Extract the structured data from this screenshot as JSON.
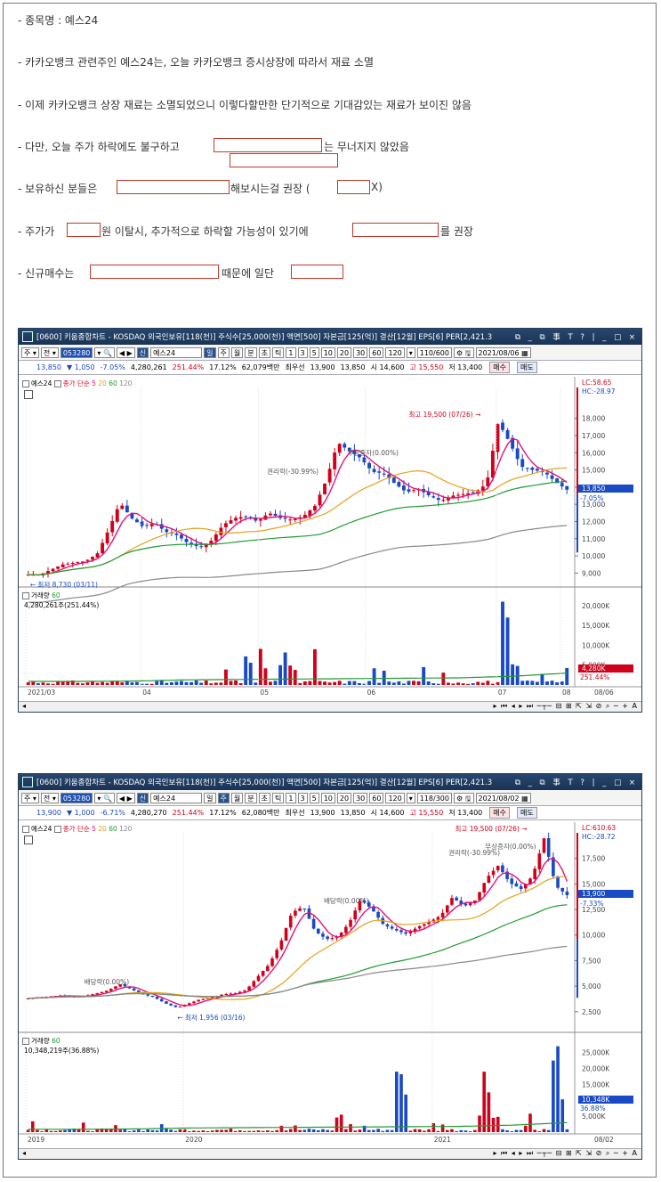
{
  "text": {
    "line1": "- 종목명 : 예스24",
    "line2": "- 카카오뱅크 관련주인 예스24는, 오늘 카카오뱅크 증시상장에 따라서 재료 소멸",
    "line3": "- 이제 카카오뱅크 상장 재료는 소멸되었으니 이렇다할만한 단기적으로 기대감있는 재료가 보이진 않음",
    "line4a": "- 다만, 오늘 주가 하락에도 불구하고",
    "line4b": "는 무너지지 않았음",
    "line5a": "- 보유하신 분들은",
    "line5b": "해보시는걸 권장 (",
    "line5c": "X)",
    "line6a": "- 주가가",
    "line6b": "원 이탈시, 추가적으로 하락할 가능성이 있기에",
    "line6c": "를 권장",
    "line7a": "- 신규매수는",
    "line7b": "때문에 일단"
  },
  "colors": {
    "up": "#d0021b",
    "down": "#1a49c6",
    "ma5": "#e0137a",
    "ma20": "#e6a11a",
    "ma60": "#1e9b32",
    "ma120": "#888888",
    "accent": "#27476f"
  },
  "charts": [
    {
      "title": "[0600] 키움종합차트 - KOSDAQ 외국인보유[118(천)] 주식수[25,000(천)] 액면[500] 자본금[125(억)] 결산[12월] EPS[6] PER[2,421.3",
      "window_controls": "⧉ _ ⧉ 事 T ? | _ □ ×",
      "toolbar": {
        "b1": "주",
        "b2": "전",
        "code": "053280",
        "name_tag": "신",
        "stock": "예스24",
        "period_day": "일",
        "period_week": "주",
        "period_month": "월",
        "period_min": "분",
        "period_sec": "초",
        "period_tick": "틱",
        "intervals": [
          "1",
          "3",
          "5",
          "10",
          "20",
          "30",
          "60",
          "120"
        ],
        "count": "110/600",
        "date": "2021/08/06"
      },
      "quote": {
        "price": "13,850",
        "arrow": "▼",
        "change": "1,050",
        "change_pct": "-7.05%",
        "volume": "4,280,261",
        "vol_ratio": "251.44%",
        "turnover": "17.12%",
        "amount": "62,079백만",
        "best_ask_label": "최우선",
        "ask": "13,900",
        "bid": "13,850",
        "open_label": "시",
        "open": "14,600",
        "high_label": "고",
        "high": "15,550",
        "low_label": "저",
        "low": "13,400",
        "buy": "매수",
        "sell": "매도"
      },
      "legend_price": {
        "name": "예스24",
        "ma_label": "종가 단순",
        "ma": [
          "5",
          "20",
          "60",
          "120"
        ]
      },
      "legend_vol": {
        "name": "거래량",
        "ma": "60",
        "value": "4,280,261주(251.44%)"
      },
      "price_axis": [
        "18,000",
        "17,000",
        "16,000",
        "15,000",
        "14,000",
        "13,000",
        "12,000",
        "11,000",
        "10,000",
        "9,000"
      ],
      "lc": "LC:58.65",
      "hc": "HC:-28.97",
      "price_tag": "13,850",
      "pct_tag": "-7.05%",
      "vol_axis": [
        "20,000K",
        "15,000K",
        "10,000K",
        "5,000K"
      ],
      "vol_tag": "4,280K",
      "vol_pct": "251.44%",
      "annotations": {
        "high": "최고 19,500 (07/26)",
        "low": "최저 8,730 (03/11)",
        "ann1": "권리락(-30.99%)",
        "ann2": "무상증자(0.00%)"
      },
      "x_labels": [
        "2021/03",
        "04",
        "05",
        "06",
        "07",
        "08"
      ],
      "x_end": "08/06"
    },
    {
      "title": "[0600] 키움종합차트 - KOSDAQ 외국인보유[118(천)] 주식수[25,000(천)] 액면[500] 자본금[125(억)] 결산[12월] EPS[6] PER[2,421.3",
      "window_controls": "⧉ _ ⧉ 事 T ? | _ □ ×",
      "toolbar": {
        "b1": "주",
        "b2": "전",
        "code": "053280",
        "name_tag": "신",
        "stock": "예스24",
        "period_day": "일",
        "period_week": "주",
        "period_month": "월",
        "period_min": "분",
        "period_sec": "초",
        "period_tick": "틱",
        "intervals": [
          "1",
          "3",
          "5",
          "10",
          "20",
          "30",
          "60",
          "120"
        ],
        "count": "118/300",
        "date": "2021/08/02"
      },
      "quote": {
        "price": "13,900",
        "arrow": "▼",
        "change": "1,000",
        "change_pct": "-6.71%",
        "volume": "4,280,270",
        "vol_ratio": "251.44%",
        "turnover": "17.12%",
        "amount": "62,080백만",
        "best_ask_label": "최우선",
        "ask": "13,900",
        "bid": "13,850",
        "open_label": "시",
        "open": "14,600",
        "high_label": "고",
        "high": "15,550",
        "low_label": "저",
        "low": "13,400",
        "buy": "매수",
        "sell": "매도"
      },
      "legend_price": {
        "name": "예스24",
        "ma_label": "종가 단순",
        "ma": [
          "5",
          "20",
          "60",
          "120"
        ]
      },
      "legend_vol": {
        "name": "거래량",
        "ma": "60",
        "value": "10,348,219주(36.88%)"
      },
      "price_axis": [
        "17,500",
        "15,000",
        "12,500",
        "10,000",
        "7,500",
        "5,000",
        "2,500"
      ],
      "lc": "LC:610.63",
      "hc": "HC:-28.72",
      "price_tag": "13,900",
      "pct_tag": "-7.33%",
      "vol_axis": [
        "25,000K",
        "20,000K",
        "15,000K",
        "5,000K"
      ],
      "vol_tag": "10,348K",
      "vol_pct": "36.88%",
      "annotations": {
        "high": "최고 19,500 (07/26)",
        "low": "최저 1,956 (03/16)",
        "ann1": "배당락(0.00%)",
        "ann2": "배당락(0.00%)",
        "ann3": "권리락(-30.99%)",
        "ann4": "무상증자(0.00%)"
      },
      "x_labels": [
        "2019",
        "2020",
        "2021"
      ],
      "x_end": "08/02"
    }
  ]
}
